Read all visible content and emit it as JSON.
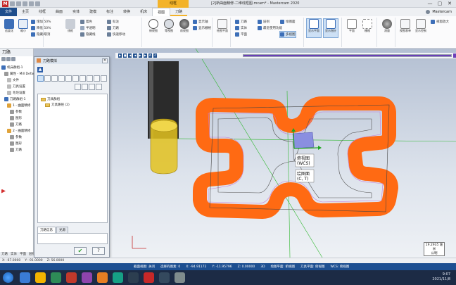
{
  "app": {
    "window_title": "[2]新曲面精修-二维线框图.mcam* - Mastercam 2020",
    "context_tab_title": "线框",
    "logo_text": "M",
    "window_controls": [
      "—",
      "▢",
      "✕"
    ]
  },
  "ribbon_tabs": [
    "文件",
    "主页",
    "线框",
    "曲面",
    "实体",
    "建模",
    "标注",
    "转换",
    "机床",
    "视图",
    "刀路"
  ],
  "ribbon_active_tab": "刀路",
  "user": {
    "name": "Mastercam"
  },
  "ribbon": {
    "groups": [
      {
        "label": ""
      },
      {
        "label": ""
      },
      {
        "label": ""
      },
      {
        "label": ""
      },
      {
        "label": ""
      },
      {
        "label": ""
      },
      {
        "label": ""
      },
      {
        "label": ""
      },
      {
        "label": ""
      }
    ],
    "small_buttons": {
      "transparency_1": "增加 50%",
      "transparency_2": "降低 50%",
      "hidden": "隐藏/取消",
      "show_axes": "显示轴",
      "show_grid": "显示栅格",
      "show_gnomon": "显示指针",
      "wireframe": "线框",
      "shaded": "着色",
      "translucent": "半透明",
      "hidden_line": "隐藏线",
      "multi_layer": "多视图",
      "show_dim": "标注",
      "show_toolpath": "刀路",
      "show_cplane": "绘图面",
      "show_rapid": "快速移动"
    },
    "big_buttons": {
      "fit": "适度化",
      "unzoom": "缩小",
      "zoom_win": "视窗放大",
      "top": "俯视图",
      "iso": "等视图",
      "back": "前视图",
      "cplane_gnomon": "绘图平面",
      "view_sheets": "视图表单",
      "planes": "平面",
      "grid": "栅格",
      "show_gnomon2": "显示平面",
      "measure": "测量",
      "display_control": "显示控制"
    }
  },
  "left_panel": {
    "title": "刀路",
    "tree": [
      "机床群组-1",
      "属性 - Mill Default",
      "文件",
      "刀具设置",
      "毛坯设置",
      "刀路群组-1",
      "1 - 曲面精修",
      "参数",
      "图形",
      "刀路",
      "2 - 曲面精修",
      "参数",
      "图形",
      "刀路"
    ],
    "bottom_tabs": [
      "刀路",
      "实体",
      "平面",
      "层别",
      "最近使用功能"
    ]
  },
  "dialog": {
    "title": "刀路模拟",
    "close": "✕",
    "up_arrow": "▲",
    "list_items": [
      "刀具群组",
      "刀具路径 (2)"
    ],
    "tabs": [
      "刀路信息",
      "光源"
    ],
    "ok_glyph": "✔",
    "help_glyph": "?"
  },
  "viewport": {
    "labels": {
      "wcs_line1": "俯视图",
      "wcs_line2": "(WCS)",
      "cplane_line1": "绘图面",
      "cplane_line2": "(C, T)"
    },
    "scale": {
      "value": "19.2935 毫米",
      "unit": "公制"
    },
    "simulation": {
      "progress_percent": 100
    }
  },
  "status": {
    "left": [
      "X: -67.0000",
      "Y: -91.0000",
      "Z: 56.0000"
    ],
    "items": [
      "3D",
      "绘图平面: 俯视图",
      "刀具平面: 俯视图",
      "WCS: 俯视图"
    ]
  },
  "coords": {
    "items": [
      "截面视图: 关闭",
      "选择的图素: 0",
      "X: -94.91172",
      "Y: -11.95796",
      "Z: 0.00000",
      "3D",
      "绘图平面: 俯视图",
      "刀具平面: 俯视图",
      "WCS: 俯视图"
    ]
  },
  "taskbar": {
    "time": "9:07",
    "date": "2021/11/8"
  },
  "colors": {
    "toolpath_orange": "#ff6a13",
    "tool_yellow": "#e3c21e",
    "stock_box": "#8a8fe0",
    "ribbon_blue": "#1f4e8c",
    "status_blue": "#1d4f91"
  }
}
